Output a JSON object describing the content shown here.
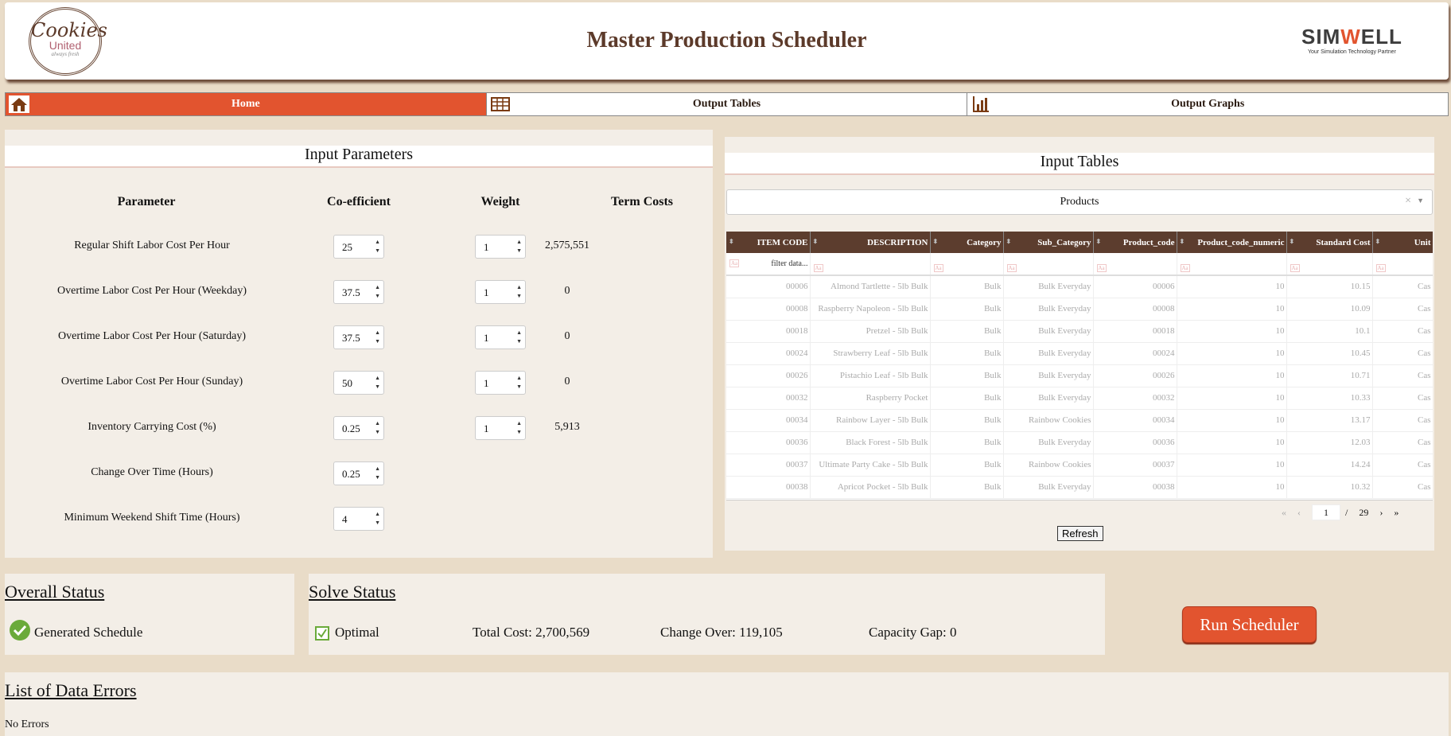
{
  "header": {
    "logo_text": "Cookies United",
    "logo_tagline": "always fresh",
    "title": "Master Production Scheduler",
    "brand": "SIMWELL",
    "brand_tagline": "Your Simulation Technology Partner"
  },
  "nav": {
    "tabs": [
      {
        "label": "Home",
        "icon": "home-icon",
        "active": true
      },
      {
        "label": "Output Tables",
        "icon": "table-icon"
      },
      {
        "label": "Output Graphs",
        "icon": "bar-chart-icon"
      }
    ]
  },
  "params": {
    "title": "Input Parameters",
    "headers": [
      "Parameter",
      "Co-efficient",
      "Weight",
      "Term Costs"
    ],
    "rows": [
      {
        "label": "Regular Shift Labor Cost Per Hour",
        "coef": "25",
        "weight": "1",
        "cost": "2,575,551"
      },
      {
        "label": "Overtime Labor Cost Per Hour (Weekday)",
        "coef": "37.5",
        "weight": "1",
        "cost": "0"
      },
      {
        "label": "Overtime Labor Cost Per Hour (Saturday)",
        "coef": "37.5",
        "weight": "1",
        "cost": "0"
      },
      {
        "label": "Overtime Labor Cost Per Hour (Sunday)",
        "coef": "50",
        "weight": "1",
        "cost": "0"
      },
      {
        "label": "Inventory Carrying Cost (%)",
        "coef": "0.25",
        "weight": "1",
        "cost": "5,913"
      },
      {
        "label": "Change Over Time (Hours)",
        "coef": "0.25"
      },
      {
        "label": "Minimum Weekend Shift Time (Hours)",
        "coef": "4"
      }
    ]
  },
  "tables": {
    "title": "Input Tables",
    "selected": "Products",
    "filter_placeholder": "filter data...",
    "columns": [
      "ITEM CODE",
      "DESCRIPTION",
      "Category",
      "Sub_Category",
      "Product_code",
      "Product_code_numeric",
      "Standard Cost",
      "Unit"
    ],
    "rows": [
      [
        "00006",
        "Almond Tartlette - 5lb Bulk",
        "Bulk",
        "Bulk Everyday",
        "00006",
        "10",
        "10.15",
        "Cas"
      ],
      [
        "00008",
        "Raspberry Napoleon - 5lb Bulk",
        "Bulk",
        "Bulk Everyday",
        "00008",
        "10",
        "10.09",
        "Cas"
      ],
      [
        "00018",
        "Pretzel - 5lb Bulk",
        "Bulk",
        "Bulk Everyday",
        "00018",
        "10",
        "10.1",
        "Cas"
      ],
      [
        "00024",
        "Strawberry Leaf - 5lb Bulk",
        "Bulk",
        "Bulk Everyday",
        "00024",
        "10",
        "10.45",
        "Cas"
      ],
      [
        "00026",
        "Pistachio Leaf - 5lb Bulk",
        "Bulk",
        "Bulk Everyday",
        "00026",
        "10",
        "10.71",
        "Cas"
      ],
      [
        "00032",
        "Raspberry Pocket",
        "Bulk",
        "Bulk Everyday",
        "00032",
        "10",
        "10.33",
        "Cas"
      ],
      [
        "00034",
        "Rainbow Layer - 5lb Bulk",
        "Bulk",
        "Rainbow Cookies",
        "00034",
        "10",
        "13.17",
        "Cas"
      ],
      [
        "00036",
        "Black Forest - 5lb Bulk",
        "Bulk",
        "Bulk Everyday",
        "00036",
        "10",
        "12.03",
        "Cas"
      ],
      [
        "00037",
        "Ultimate Party Cake - 5lb Bulk",
        "Bulk",
        "Rainbow Cookies",
        "00037",
        "10",
        "14.24",
        "Cas"
      ],
      [
        "00038",
        "Apricot Pocket - 5lb Bulk",
        "Bulk",
        "Bulk Everyday",
        "00038",
        "10",
        "10.32",
        "Cas"
      ]
    ],
    "page": "1",
    "page_sep": "/",
    "total_pages": "29",
    "refresh_label": "Refresh"
  },
  "overall": {
    "title": "Overall Status",
    "status": "Generated Schedule"
  },
  "solve": {
    "title": "Solve Status",
    "status": "Optimal",
    "total_cost": "Total Cost: 2,700,569",
    "change_over": "Change Over: 119,105",
    "capacity_gap": "Capacity Gap: 0"
  },
  "run_label": "Run Scheduler",
  "errors": {
    "title": "List of Data Errors",
    "text": "No Errors"
  },
  "colors": {
    "accent": "#e2542f",
    "brown": "#5c3d2e",
    "background": "#e9dcc8",
    "panel": "#f3eee7",
    "success": "#6aaa3a"
  }
}
